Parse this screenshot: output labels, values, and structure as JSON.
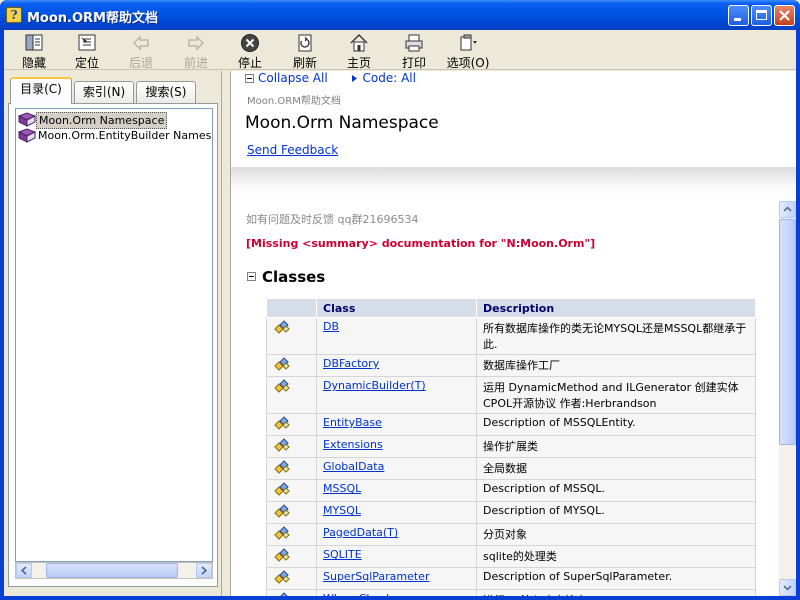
{
  "window": {
    "title": "Moon.ORM帮助文档",
    "icon": "help-file-icon"
  },
  "toolbar": {
    "items": [
      {
        "label": "隐藏",
        "icon": "hide-icon",
        "enabled": true
      },
      {
        "label": "定位",
        "icon": "locate-icon",
        "enabled": true
      },
      {
        "label": "后退",
        "icon": "back-arrow-icon",
        "enabled": false
      },
      {
        "label": "前进",
        "icon": "forward-arrow-icon",
        "enabled": false
      },
      {
        "label": "停止",
        "icon": "stop-icon",
        "enabled": true
      },
      {
        "label": "刷新",
        "icon": "refresh-icon",
        "enabled": true
      },
      {
        "label": "主页",
        "icon": "home-icon",
        "enabled": true
      },
      {
        "label": "打印",
        "icon": "print-icon",
        "enabled": true
      },
      {
        "label": "选项(O)",
        "icon": "options-icon",
        "enabled": true
      }
    ]
  },
  "navigation": {
    "tabs": [
      {
        "label": "目录(C)",
        "active": true
      },
      {
        "label": "索引(N)",
        "active": false
      },
      {
        "label": "搜索(S)",
        "active": false
      }
    ],
    "tree": [
      {
        "label": "Moon.Orm Namespace",
        "selected": true,
        "icon": "book-icon"
      },
      {
        "label": "Moon.Orm.EntityBuilder Namespace",
        "selected": false,
        "icon": "book-icon"
      }
    ]
  },
  "topic": {
    "collapse_all": "Collapse All",
    "code_filter": "Code: All",
    "doc_title": "Moon.ORM帮助文档",
    "namespace_title": "Moon.Orm Namespace",
    "feedback": "Send Feedback",
    "note": "如有问题及时反馈  qq群21696534",
    "missing": "[Missing <summary> documentation for \"N:Moon.Orm\"]",
    "section_title": "Classes",
    "table": {
      "headers": [
        "",
        "Class",
        "Description"
      ],
      "rows": [
        {
          "name": "DB",
          "desc": "所有数据库操作的类无论MYSQL还是MSSQL都继承于此."
        },
        {
          "name": "DBFactory",
          "desc": "数据库操作工厂"
        },
        {
          "name": "DynamicBuilder(T)",
          "desc": "运用  DynamicMethod and ILGenerator 创建实体  CPOL开源协议  作者:Herbrandson"
        },
        {
          "name": "EntityBase",
          "desc": "Description of MSSQLEntity."
        },
        {
          "name": "Extensions",
          "desc": "操作扩展类"
        },
        {
          "name": "GlobalData",
          "desc": "全局数据"
        },
        {
          "name": "MSSQL",
          "desc": "Description of MSSQL."
        },
        {
          "name": "MYSQL",
          "desc": "Description of MYSQL."
        },
        {
          "name": "PagedData(T)",
          "desc": "分页对象"
        },
        {
          "name": "SQLITE",
          "desc": "sqlite的处理类"
        },
        {
          "name": "SuperSqlParameter",
          "desc": "Description of SuperSqlParameter."
        },
        {
          "name": "WhereChecker",
          "desc": "进行sql注入攻击检查"
        }
      ]
    }
  }
}
